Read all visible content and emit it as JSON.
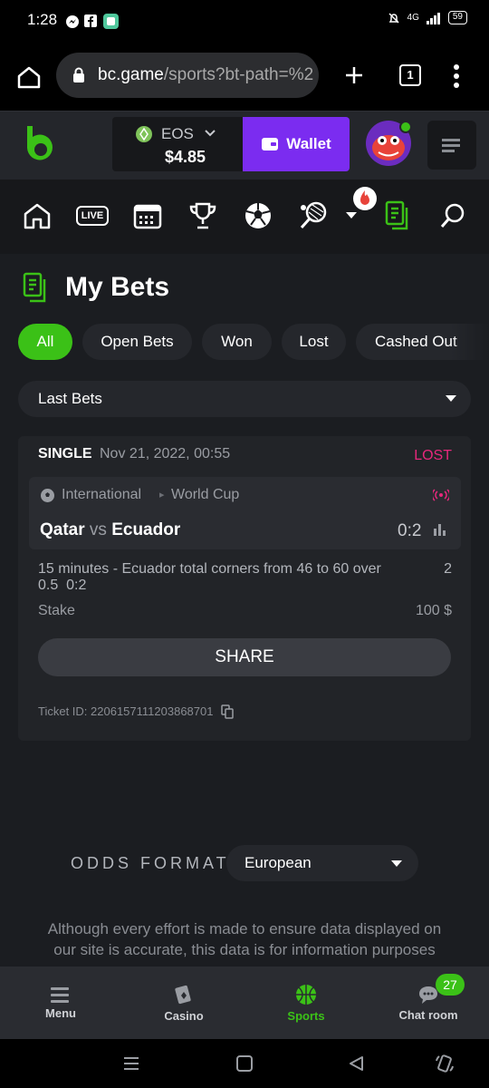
{
  "status_bar": {
    "time": "1:28",
    "battery": "59",
    "network": "4G"
  },
  "browser": {
    "url_host": "bc.game",
    "url_path": "/sports?bt-path=%2",
    "tab_count": "1"
  },
  "header": {
    "currency": "EOS",
    "balance": "$4.85",
    "wallet_label": "Wallet"
  },
  "sport_nav": {
    "live_label": "LIVE"
  },
  "page": {
    "title": "My Bets",
    "chips": [
      "All",
      "Open Bets",
      "Won",
      "Lost",
      "Cashed Out"
    ],
    "filter_value": "Last Bets"
  },
  "bet": {
    "type": "SINGLE",
    "date": "Nov 21, 2022, 00:55",
    "result": "LOST",
    "league_country": "International",
    "league_name": "World Cup",
    "team_home": "Qatar",
    "vs": "vs",
    "team_away": "Ecuador",
    "score": "0:2",
    "market": "15 minutes - Ecuador total corners from 46 to 60 over 0.5",
    "market_score": "0:2",
    "odds": "2",
    "stake_label": "Stake",
    "stake_value": "100 $",
    "share_label": "SHARE",
    "ticket_label": "Ticket ID: 2206157111203868701"
  },
  "odds_format": {
    "label": "ODDS FORMAT",
    "value": "European"
  },
  "disclaimer": "Although every effort is made to ensure data displayed on our site is accurate, this data is for information purposes",
  "bottom_tabs": [
    {
      "label": "Menu",
      "icon": "menu-icon"
    },
    {
      "label": "Casino",
      "icon": "casino-icon"
    },
    {
      "label": "Sports",
      "icon": "basketball-icon"
    },
    {
      "label": "Chat room",
      "icon": "chat-icon"
    }
  ],
  "chat_badge": "27",
  "colors": {
    "accent": "#3bc117",
    "wallet": "#7b2cf0",
    "lost": "#e8287c"
  }
}
